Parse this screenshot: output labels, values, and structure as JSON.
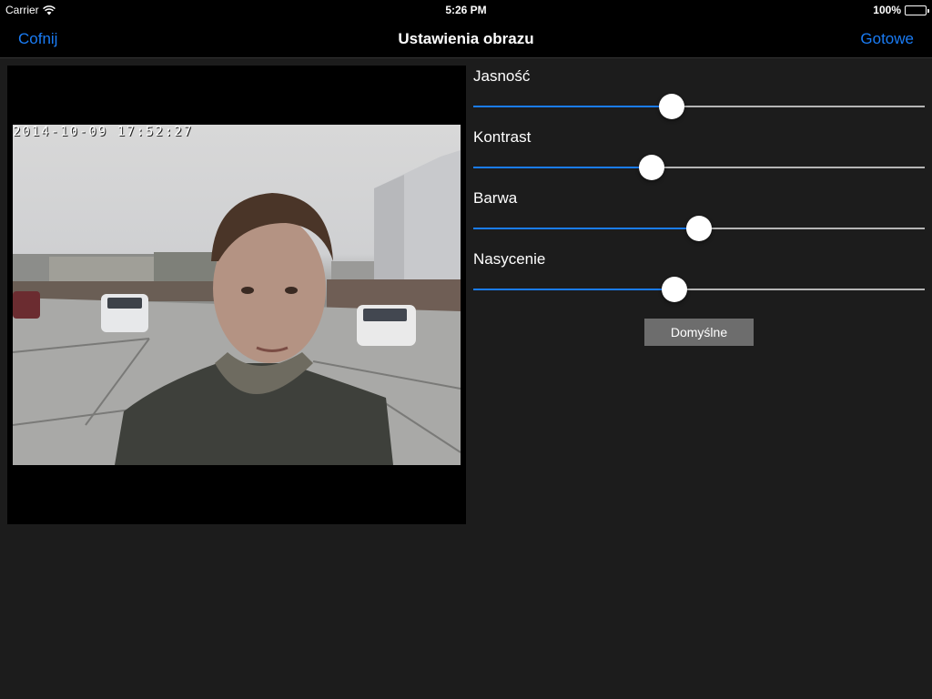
{
  "status": {
    "carrier": "Carrier",
    "time": "5:26 PM",
    "battery": "100%"
  },
  "nav": {
    "back_label": "Cofnij",
    "title": "Ustawienia obrazu",
    "done_label": "Gotowe"
  },
  "video": {
    "timestamp": "2014-10-09  17:52:27"
  },
  "sliders": [
    {
      "label": "Jasność",
      "value": 0.44
    },
    {
      "label": "Kontrast",
      "value": 0.395
    },
    {
      "label": "Barwa",
      "value": 0.5
    },
    {
      "label": "Nasycenie",
      "value": 0.445
    }
  ],
  "default_button": "Domyślne",
  "colors": {
    "accent": "#1a7cf5",
    "background": "#1c1c1c",
    "bar": "#000000",
    "track": "#b5b5b5",
    "button": "#6d6d6d"
  }
}
